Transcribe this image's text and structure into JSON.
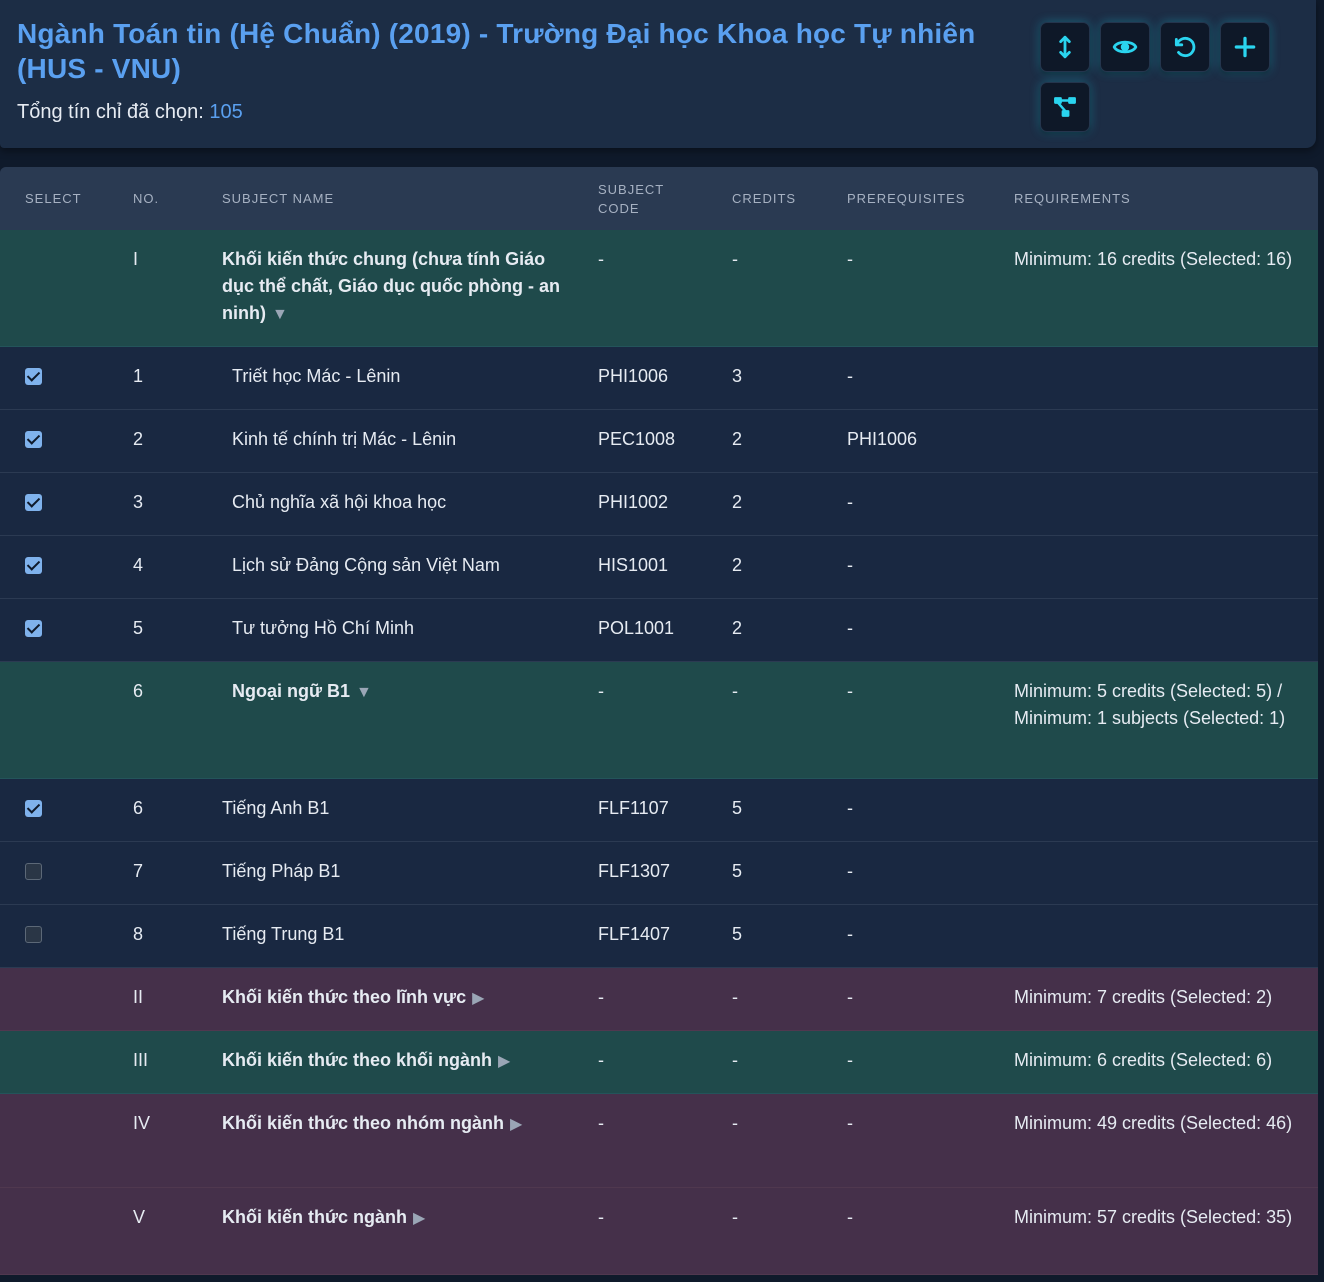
{
  "header": {
    "title": "Ngành Toán tin (Hệ Chuẩn) (2019) - Trường Đại học Khoa học Tự nhiên (HUS - VNU)",
    "total_label": "Tổng tín chỉ đã chọn:",
    "total_value": "105"
  },
  "toolbar": [
    {
      "name": "expand-collapse-button",
      "icon": "vertical-arrows-icon"
    },
    {
      "name": "toggle-visibility-button",
      "icon": "eye-icon"
    },
    {
      "name": "reset-button",
      "icon": "undo-icon"
    },
    {
      "name": "add-button",
      "icon": "plus-icon"
    },
    {
      "name": "prerequisite-graph-button",
      "icon": "graph-tree-icon"
    }
  ],
  "columns": {
    "select": "SELECT",
    "no": "NO.",
    "name": "SUBJECT NAME",
    "code_line1": "SUBJECT",
    "code_line2": "CODE",
    "credits": "CREDITS",
    "prereq": "PREREQUISITES",
    "req": "REQUIREMENTS"
  },
  "rows": [
    {
      "type": "group",
      "no": "I",
      "name": "Khối kiến thức chung (chưa tính Giáo dục thể chất, Giáo dục quốc phòng - an ninh)",
      "caret": "▼",
      "code": "-",
      "credits": "-",
      "prereq": "-",
      "req": "Minimum: 16 credits (Selected: 16)"
    },
    {
      "type": "subject",
      "checked": true,
      "no": "1",
      "name": "Triết học Mác - Lênin",
      "code": "PHI1006",
      "credits": "3",
      "prereq": "-",
      "req": ""
    },
    {
      "type": "subject",
      "checked": true,
      "no": "2",
      "name": "Kinh tế chính trị Mác - Lênin",
      "code": "PEC1008",
      "credits": "2",
      "prereq": "PHI1006",
      "req": ""
    },
    {
      "type": "subject",
      "checked": true,
      "no": "3",
      "name": "Chủ nghĩa xã hội khoa học",
      "code": "PHI1002",
      "credits": "2",
      "prereq": "-",
      "req": ""
    },
    {
      "type": "subject",
      "checked": true,
      "no": "4",
      "name": "Lịch sử Đảng Cộng sản Việt Nam",
      "code": "HIS1001",
      "credits": "2",
      "prereq": "-",
      "req": ""
    },
    {
      "type": "subject",
      "checked": true,
      "no": "5",
      "name": "Tư tưởng Hồ Chí Minh",
      "code": "POL1001",
      "credits": "2",
      "prereq": "-",
      "req": ""
    },
    {
      "type": "group",
      "no": "6",
      "name": "Ngoại ngữ B1",
      "caret": "▼",
      "code": "-",
      "credits": "-",
      "prereq": "-",
      "req": "Minimum: 5 credits (Selected: 5) / Minimum: 1 subjects (Selected: 1)"
    },
    {
      "type": "subject",
      "checked": true,
      "no": "6",
      "name": "Tiếng Anh B1",
      "code": "FLF1107",
      "credits": "5",
      "prereq": "-",
      "req": ""
    },
    {
      "type": "subject",
      "checked": false,
      "no": "7",
      "name": "Tiếng Pháp B1",
      "code": "FLF1307",
      "credits": "5",
      "prereq": "-",
      "req": ""
    },
    {
      "type": "subject",
      "checked": false,
      "no": "8",
      "name": "Tiếng Trung B1",
      "code": "FLF1407",
      "credits": "5",
      "prereq": "-",
      "req": ""
    },
    {
      "type": "group",
      "no": "II",
      "name": "Khối kiến thức theo lĩnh vực",
      "caret": "▶",
      "code": "-",
      "credits": "-",
      "prereq": "-",
      "req": "Minimum: 7 credits (Selected: 2)"
    },
    {
      "type": "group",
      "no": "III",
      "name": "Khối kiến thức theo khối ngành",
      "caret": "▶",
      "code": "-",
      "credits": "-",
      "prereq": "-",
      "req": "Minimum: 6 credits (Selected: 6)"
    },
    {
      "type": "group",
      "no": "IV",
      "name": "Khối kiến thức theo nhóm ngành",
      "caret": "▶",
      "code": "-",
      "credits": "-",
      "prereq": "-",
      "req": "Minimum: 49 credits (Selected: 46)"
    },
    {
      "type": "group",
      "no": "V",
      "name": "Khối kiến thức ngành",
      "caret": "▶",
      "code": "-",
      "credits": "-",
      "prereq": "-",
      "req": "Minimum: 57 credits (Selected: 35)"
    }
  ],
  "colors": {
    "accent": "#5aa0f0",
    "icon": "#2ad4ef",
    "group_satisfied": "#1f4a4b",
    "group_unsatisfied": "#45304a",
    "row_bg": "#192841"
  }
}
